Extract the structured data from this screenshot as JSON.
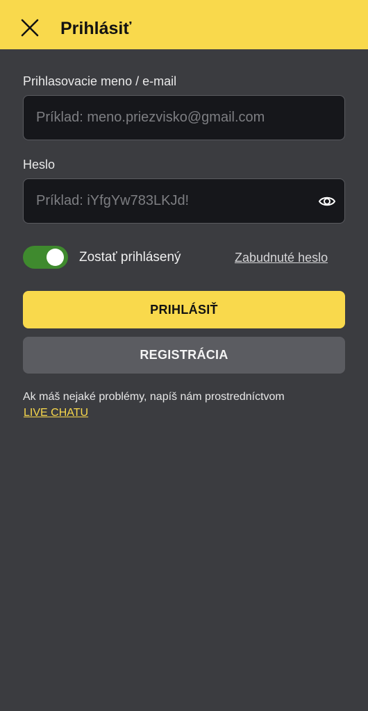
{
  "header": {
    "title": "Prihlásiť"
  },
  "form": {
    "username": {
      "label": "Prihlasovacie meno / e-mail",
      "placeholder": "Príklad: meno.priezvisko@gmail.com",
      "value": ""
    },
    "password": {
      "label": "Heslo",
      "placeholder": "Príklad: iYfgYw783LKJd!",
      "value": ""
    },
    "stay_logged_in": {
      "label": "Zostať prihlásený",
      "checked": true
    },
    "forgot_password_label": "Zabudnuté heslo",
    "login_button_label": "PRIHLÁSIŤ",
    "register_button_label": "REGISTRÁCIA"
  },
  "help": {
    "text": "Ak máš nejaké problémy, napíš nám prostredníctvom",
    "link_label": "LIVE CHATU"
  },
  "icons": {
    "close": "close-icon",
    "eye": "eye-icon"
  },
  "colors": {
    "accent": "#f9d94c",
    "background": "#3b3c40",
    "field_background": "#16171b",
    "toggle_on": "#3f8a2e",
    "secondary_button": "#5b5c61"
  }
}
